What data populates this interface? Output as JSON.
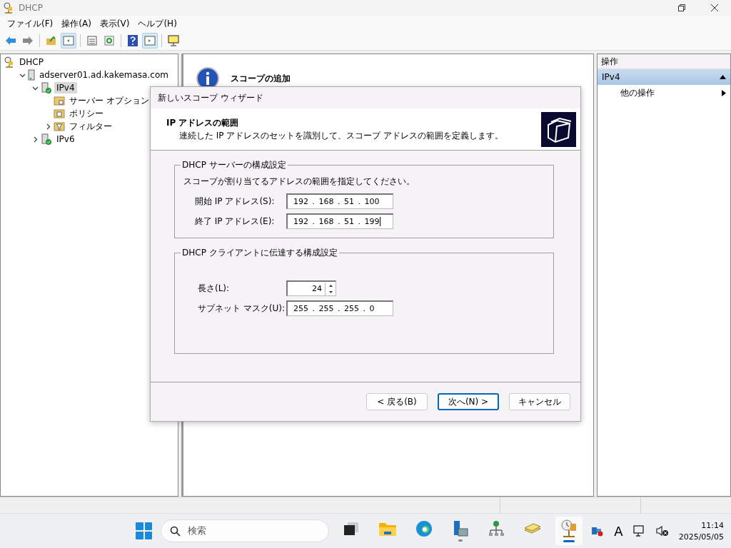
{
  "window": {
    "title": "DHCP"
  },
  "menu": [
    {
      "label": "ファイル(F)"
    },
    {
      "label": "操作(A)"
    },
    {
      "label": "表示(V)"
    },
    {
      "label": "ヘルプ(H)"
    }
  ],
  "toolbar": [
    {
      "kind": "back",
      "pressed": false
    },
    {
      "kind": "forward",
      "pressed": false
    },
    {
      "kind": "sep"
    },
    {
      "kind": "up",
      "pressed": false
    },
    {
      "kind": "tree",
      "pressed": true
    },
    {
      "kind": "sep"
    },
    {
      "kind": "list",
      "pressed": false
    },
    {
      "kind": "refresh",
      "pressed": false
    },
    {
      "kind": "sep"
    },
    {
      "kind": "help",
      "pressed": false
    },
    {
      "kind": "action",
      "pressed": true
    },
    {
      "kind": "sep"
    },
    {
      "kind": "monitor",
      "pressed": false
    }
  ],
  "tree": [
    {
      "label": "DHCP",
      "kind": "root",
      "selected": false,
      "children": [
        {
          "label": "adserver01.ad.kakemasa.com",
          "kind": "server",
          "expanded": true,
          "selected": false,
          "children": [
            {
              "label": "IPv4",
              "kind": "protocol",
              "expanded": true,
              "selected": true,
              "children": [
                {
                  "label": "サーバー オプション",
                  "kind": "options",
                  "selected": false
                },
                {
                  "label": "ポリシー",
                  "kind": "policy",
                  "selected": false
                },
                {
                  "label": "フィルター",
                  "kind": "filter",
                  "expanded": false,
                  "selected": false
                }
              ]
            },
            {
              "label": "IPv6",
              "kind": "protocol",
              "expanded": false,
              "selected": false
            }
          ]
        }
      ]
    }
  ],
  "content": {
    "title": "スコープの追加"
  },
  "actions": {
    "header": "操作",
    "section": {
      "label": "IPv4",
      "expanded": true
    },
    "items": [
      {
        "label": "他の操作"
      }
    ]
  },
  "dialog": {
    "title": "新しいスコープ ウィザード",
    "heading": "IP アドレスの範囲",
    "description": "連続した IP アドレスのセットを識別して、スコープ アドレスの範囲を定義します。",
    "groups": [
      {
        "legend": "DHCP サーバーの構成設定",
        "instruction": "スコープが割り当てるアドレスの範囲を指定してください。",
        "fields": [
          {
            "kind": "ip",
            "label": "開始 IP アドレス(S):",
            "value": "192 . 168 . 51 . 100",
            "focused": false
          },
          {
            "kind": "ip",
            "label": "終了 IP アドレス(E):",
            "value": "192 . 168 . 51 . 199",
            "focused": true
          }
        ]
      },
      {
        "legend": "DHCP クライアントに伝達する構成設定",
        "fields": [
          {
            "kind": "spin",
            "label": "長さ(L):",
            "value": "24",
            "focused": false
          },
          {
            "kind": "ip",
            "label": "サブネット マスク(U):",
            "value": "255 . 255 . 255 . 0",
            "focused": false
          }
        ]
      }
    ],
    "buttons": [
      {
        "label": "< 戻る(B)",
        "default": false
      },
      {
        "label": "次へ(N) >",
        "default": true
      },
      {
        "label": "キャンセル",
        "default": false
      }
    ]
  },
  "taskbar": {
    "search": {
      "placeholder": "検索"
    },
    "apps": [
      {
        "kind": "taskview",
        "running": false,
        "active": false
      },
      {
        "kind": "folder",
        "running": false,
        "active": false
      },
      {
        "kind": "browser",
        "running": false,
        "active": false
      },
      {
        "kind": "server",
        "running": true,
        "active": false
      },
      {
        "kind": "network",
        "running": false,
        "active": false
      },
      {
        "kind": "tool",
        "running": false,
        "active": false
      },
      {
        "kind": "dhcp",
        "running": true,
        "active": true
      }
    ],
    "ime": "A",
    "time": "11:14",
    "date": "2025/05/05"
  }
}
